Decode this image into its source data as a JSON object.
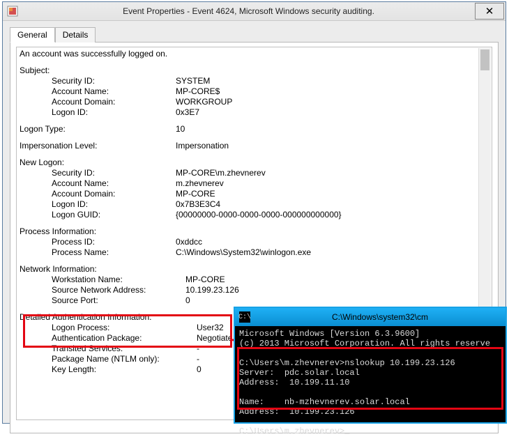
{
  "window": {
    "title": "Event Properties - Event 4624, Microsoft Windows security auditing."
  },
  "tabs": {
    "general": "General",
    "details": "Details"
  },
  "msg": "An account was successfully logged on.",
  "subject": {
    "header": "Subject:",
    "security_id_label": "Security ID:",
    "security_id": "SYSTEM",
    "account_name_label": "Account Name:",
    "account_name": "MP-CORE$",
    "account_domain_label": "Account Domain:",
    "account_domain": "WORKGROUP",
    "logon_id_label": "Logon ID:",
    "logon_id": "0x3E7"
  },
  "logon_type": {
    "label": "Logon Type:",
    "value": "10"
  },
  "impersonation": {
    "label": "Impersonation Level:",
    "value": "Impersonation"
  },
  "newlogon": {
    "header": "New Logon:",
    "security_id_label": "Security ID:",
    "security_id": "MP-CORE\\m.zhevnerev",
    "account_name_label": "Account Name:",
    "account_name": "m.zhevnerev",
    "account_domain_label": "Account Domain:",
    "account_domain": "MP-CORE",
    "logon_id_label": "Logon ID:",
    "logon_id": "0x7B3E3C4",
    "logon_guid_label": "Logon GUID:",
    "logon_guid": "{00000000-0000-0000-0000-000000000000}"
  },
  "process": {
    "header": "Process Information:",
    "pid_label": "Process ID:",
    "pid": "0xddcc",
    "pname_label": "Process Name:",
    "pname": "C:\\Windows\\System32\\winlogon.exe"
  },
  "network": {
    "header": "Network Information:",
    "ws_label": "Workstation Name:",
    "ws": "MP-CORE",
    "src_label": "Source Network Address:",
    "src": "10.199.23.126",
    "port_label": "Source Port:",
    "port": "0"
  },
  "auth": {
    "header": "Detailed Authentication Information:",
    "lp_label": "Logon Process:",
    "lp": "User32 ",
    "ap_label": "Authentication Package:",
    "ap": "Negotiate",
    "ts_label": "Transited Services:",
    "ts": "-",
    "pk_label": "Package Name (NTLM only):",
    "pk": "-",
    "kl_label": "Key Length:",
    "kl": "0"
  },
  "cmd": {
    "title": "C:\\Windows\\system32\\cm",
    "line1": "Microsoft Windows [Version 6.3.9600]",
    "line2": "(c) 2013 Microsoft Corporation. All rights reserve",
    "prompt1": "C:\\Users\\m.zhevnerev>",
    "cmd1": "nslookup 10.199.23.126",
    "srv_label": "Server:  ",
    "srv": "pdc.solar.local",
    "addr1_label": "Address:  ",
    "addr1": "10.199.11.10",
    "name_label": "Name:    ",
    "name": "nb-mzhevnerev.solar.local",
    "addr2_label": "Address:  ",
    "addr2": "10.199.23.126",
    "prompt2": "C:\\Users\\m.zhevnerev>",
    "cursor": "_"
  }
}
